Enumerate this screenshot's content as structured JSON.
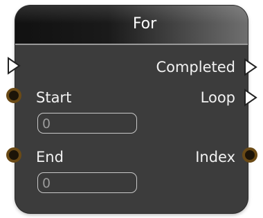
{
  "node": {
    "title": "For",
    "outputs": {
      "completed_label": "Completed",
      "loop_label": "Loop",
      "index_label": "Index"
    },
    "inputs": {
      "start_label": "Start",
      "start_value": "0",
      "end_label": "End",
      "end_value": "0"
    }
  },
  "colors": {
    "node_body": "#3c3c3c",
    "header_dark": "#111111",
    "header_light": "#6f6f6f",
    "pin_ring": "#6a4a16",
    "text": "#f2f2f2"
  },
  "icons": {
    "exec_in": "exec-triangle",
    "exec_out_completed": "exec-triangle",
    "exec_out_loop": "exec-triangle",
    "data_pin": "circle-pin"
  }
}
